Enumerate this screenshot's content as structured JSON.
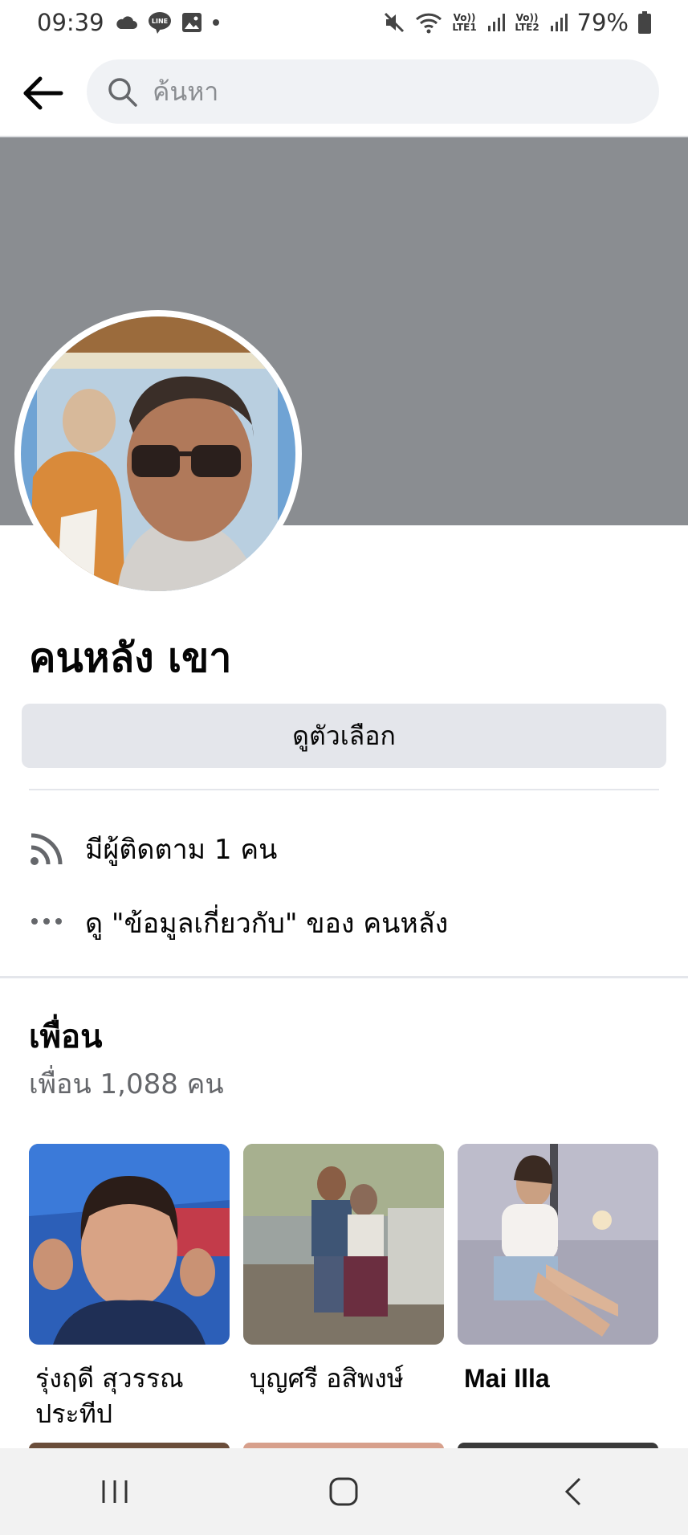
{
  "status_bar": {
    "time": "09:39",
    "lte1_label": "Vo)) LTE1",
    "lte2_label": "Vo)) LTE2",
    "battery": "79%"
  },
  "search": {
    "placeholder": "ค้นหา"
  },
  "profile": {
    "name": "คนหลัง เขา",
    "options_button": "ดูตัวเลือก",
    "followers_text": "มีผู้ติดตาม 1 คน",
    "about_text": "ดู \"ข้อมูลเกี่ยวกับ\" ของ คนหลัง"
  },
  "friends": {
    "title": "เพื่อน",
    "count_text": "เพื่อน 1,088 คน",
    "items": [
      {
        "name_line1": "รุ่งฤดี สุวรรณ",
        "name_line2": "ประทีป"
      },
      {
        "name_line1": "บุญศรี อสิพงษ์",
        "name_line2": ""
      },
      {
        "name_line1": "Mai Illa",
        "name_line2": ""
      }
    ]
  },
  "colors": {
    "cover": "#8a8d91",
    "button_bg": "#e4e6eb",
    "secondary_text": "#65676b"
  }
}
